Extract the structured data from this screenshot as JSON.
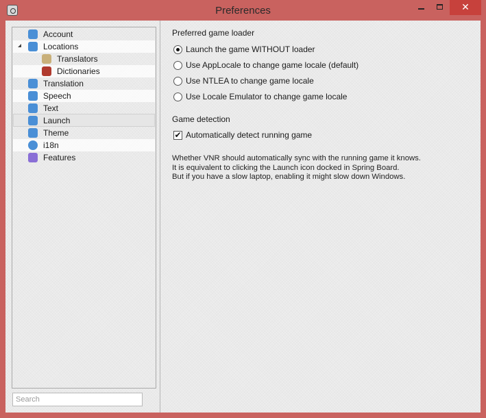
{
  "window": {
    "title": "Preferences",
    "close_glyph": "✕"
  },
  "sidebar": {
    "items": [
      {
        "label": "Account",
        "icon": "account-icon",
        "color": "#4a8fd6"
      },
      {
        "label": "Locations",
        "icon": "locations-icon",
        "color": "#4a8fd6",
        "expanded": true
      },
      {
        "label": "Translators",
        "icon": "translators-icon",
        "color": "#c9b07a"
      },
      {
        "label": "Dictionaries",
        "icon": "dictionaries-icon",
        "color": "#b03a2e"
      },
      {
        "label": "Translation",
        "icon": "translation-icon",
        "color": "#4a8fd6"
      },
      {
        "label": "Speech",
        "icon": "speech-icon",
        "color": "#4a8fd6"
      },
      {
        "label": "Text",
        "icon": "text-icon",
        "color": "#4a8fd6"
      },
      {
        "label": "Launch",
        "icon": "launch-icon",
        "color": "#4a8fd6",
        "selected": true
      },
      {
        "label": "Theme",
        "icon": "theme-icon",
        "color": "#4a8fd6"
      },
      {
        "label": "i18n",
        "icon": "globe-icon",
        "color": "#4a8fd6"
      },
      {
        "label": "Features",
        "icon": "features-icon",
        "color": "#8a6fd6"
      }
    ],
    "search": {
      "placeholder": "Search",
      "value": ""
    }
  },
  "launch": {
    "loader_section_title": "Preferred game loader",
    "loader_options": [
      {
        "label": "Launch the game WITHOUT loader",
        "checked": true
      },
      {
        "label": "Use AppLocale to change game locale (default)",
        "checked": false
      },
      {
        "label": "Use NTLEA to change game locale",
        "checked": false
      },
      {
        "label": "Use Locale Emulator to change game locale",
        "checked": false
      }
    ],
    "detection_section_title": "Game detection",
    "detect_checkbox": {
      "label": "Automatically detect running game",
      "checked": true,
      "mark": "✔"
    },
    "description": [
      "Whether VNR should automatically sync with the running game it knows.",
      "It is equivalent to clicking the Launch icon docked in Spring Board.",
      "But if you have a slow laptop, enabling it might slow down Windows."
    ]
  }
}
